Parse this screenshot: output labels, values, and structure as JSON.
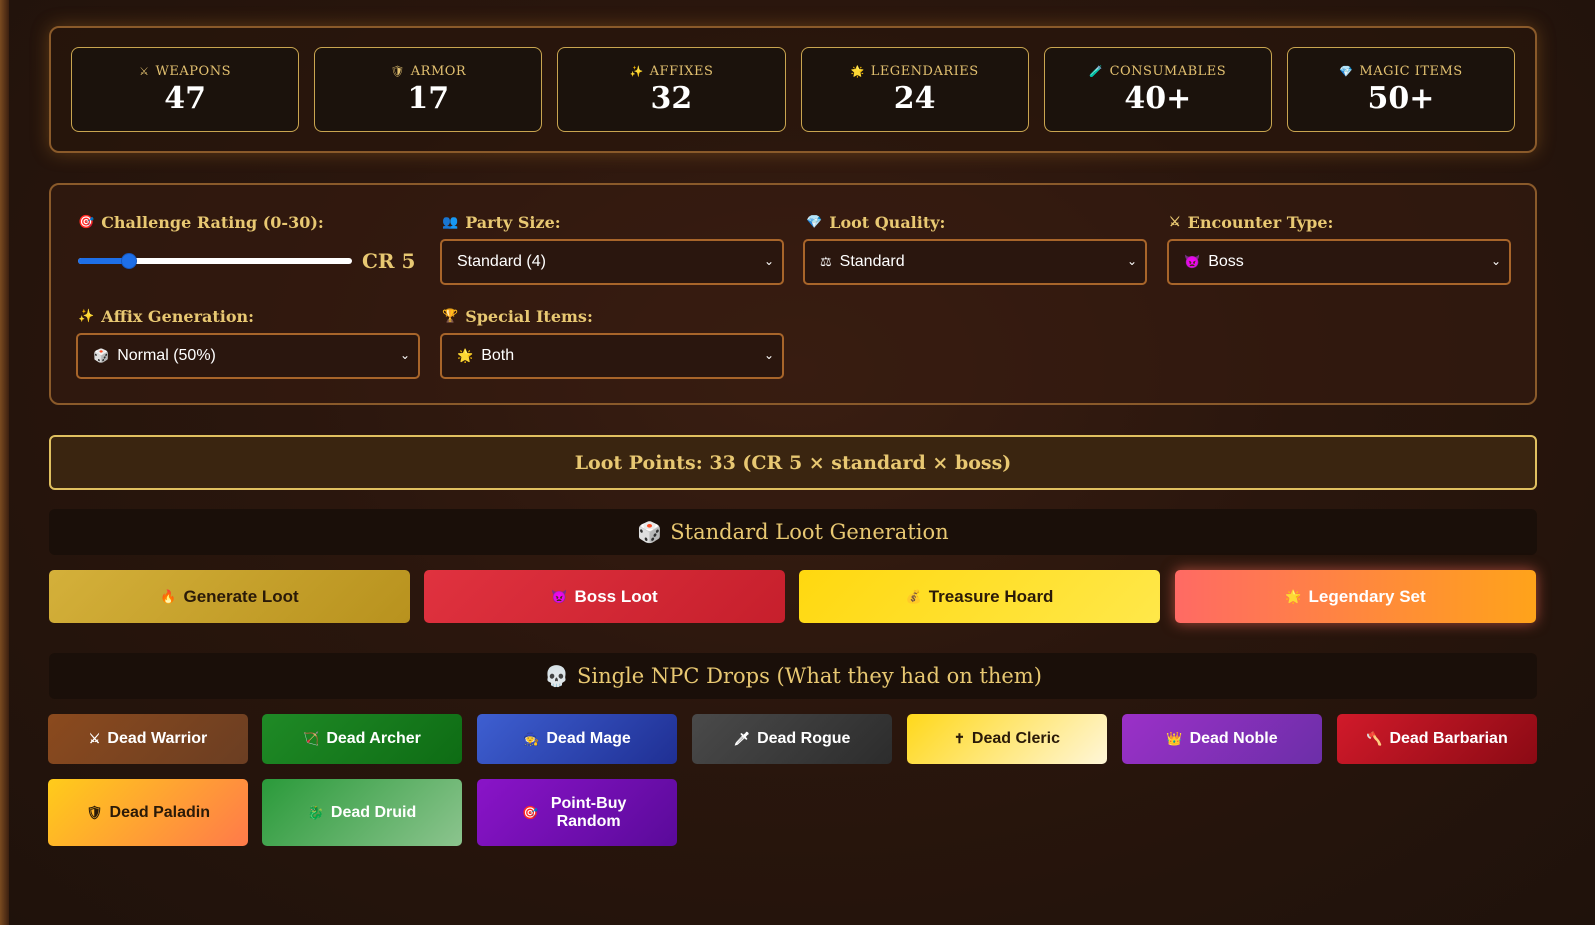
{
  "stats": [
    {
      "icon": "⚔",
      "label": "WEAPONS",
      "value": "47"
    },
    {
      "icon": "🛡",
      "label": "ARMOR",
      "value": "17"
    },
    {
      "icon": "✨",
      "label": "AFFIXES",
      "value": "32"
    },
    {
      "icon": "🌟",
      "label": "LEGENDARIES",
      "value": "24"
    },
    {
      "icon": "🧪",
      "label": "CONSUMABLES",
      "value": "40+"
    },
    {
      "icon": "💎",
      "label": "MAGIC ITEMS",
      "value": "50+"
    }
  ],
  "config": {
    "challenge_rating": {
      "icon": "🎯",
      "label": "Challenge Rating (0-30):",
      "value_text": "CR 5",
      "value": 5,
      "min": 0,
      "max": 30
    },
    "party_size": {
      "icon": "👥",
      "label": "Party Size:",
      "selected": "Standard (4)"
    },
    "loot_quality": {
      "icon": "💎",
      "label": "Loot Quality:",
      "selected_icon": "⚖",
      "selected": "Standard"
    },
    "encounter_type": {
      "icon": "⚔",
      "label": "Encounter Type:",
      "selected_icon": "👿",
      "selected": "Boss"
    },
    "affix_generation": {
      "icon": "✨",
      "label": "Affix Generation:",
      "selected_icon": "🎲",
      "selected": "Normal (50%)"
    },
    "special_items": {
      "icon": "🏆",
      "label": "Special Items:",
      "selected_icon": "🌟",
      "selected": "Both"
    }
  },
  "loot_points": "Loot Points: 33 (CR 5 × standard × boss)",
  "standard_section": {
    "icon": "🎲",
    "title": "Standard Loot Generation"
  },
  "standard_buttons": [
    {
      "icon": "🔥",
      "label": "Generate Loot"
    },
    {
      "icon": "👿",
      "label": "Boss Loot"
    },
    {
      "icon": "💰",
      "label": "Treasure Hoard"
    },
    {
      "icon": "🌟",
      "label": "Legendary Set"
    }
  ],
  "npc_section": {
    "icon": "💀",
    "title": "Single NPC Drops (What they had on them)"
  },
  "npc_buttons": [
    {
      "icon": "⚔",
      "label": "Dead Warrior"
    },
    {
      "icon": "🏹",
      "label": "Dead Archer"
    },
    {
      "icon": "🧙",
      "label": "Dead Mage"
    },
    {
      "icon": "🗡",
      "label": "Dead Rogue"
    },
    {
      "icon": "✝",
      "label": "Dead Cleric"
    },
    {
      "icon": "👑",
      "label": "Dead Noble"
    },
    {
      "icon": "🪓",
      "label": "Dead Barbarian"
    },
    {
      "icon": "🛡",
      "label": "Dead Paladin"
    },
    {
      "icon": "🐉",
      "label": "Dead Druid"
    },
    {
      "icon": "🎯",
      "label": "Point-Buy Random"
    }
  ],
  "colors": {
    "gold": "#e8c872",
    "panel_border": "#8a5a2a",
    "slider": "#1e6fe8"
  }
}
